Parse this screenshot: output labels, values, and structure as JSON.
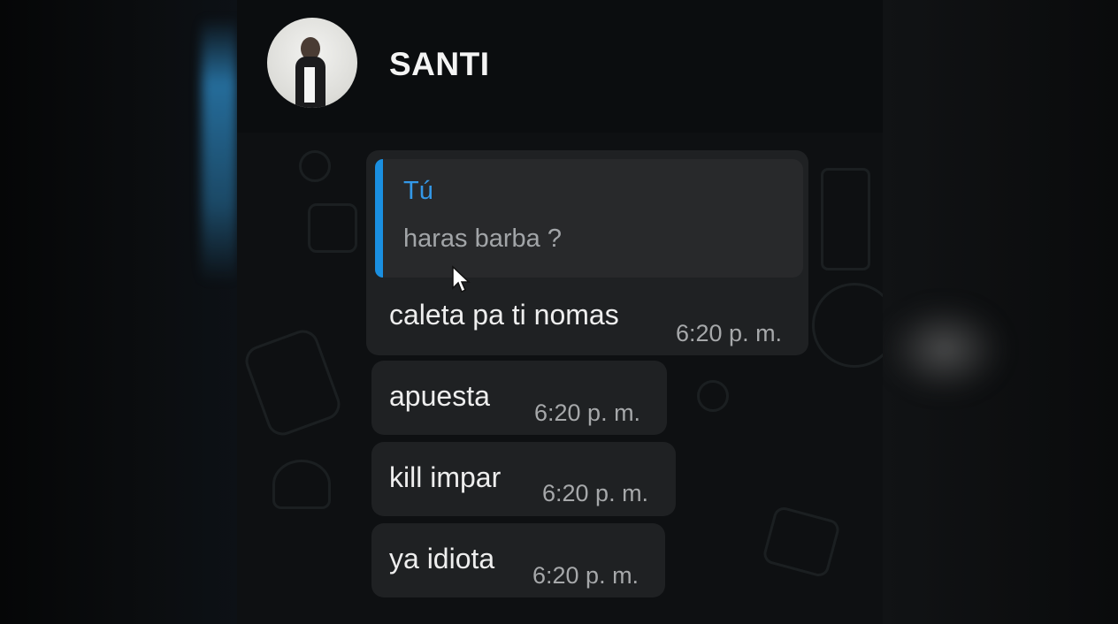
{
  "contact": {
    "name": "SANTI"
  },
  "reply_quote": {
    "author": "Tú",
    "text": "haras barba ?"
  },
  "messages": [
    {
      "text": "caleta pa ti nomas",
      "time": "6:20 p. m."
    },
    {
      "text": "apuesta",
      "time": "6:20 p. m."
    },
    {
      "text": "kill impar",
      "time": "6:20 p. m."
    },
    {
      "text": "ya idiota",
      "time": "6:20 p. m."
    }
  ],
  "colors": {
    "quote_accent": "#1a8fe0",
    "bubble": "#1f2123",
    "background": "#0e1012"
  },
  "icons": [
    "avatar-photo",
    "mouse-pointer-icon"
  ]
}
